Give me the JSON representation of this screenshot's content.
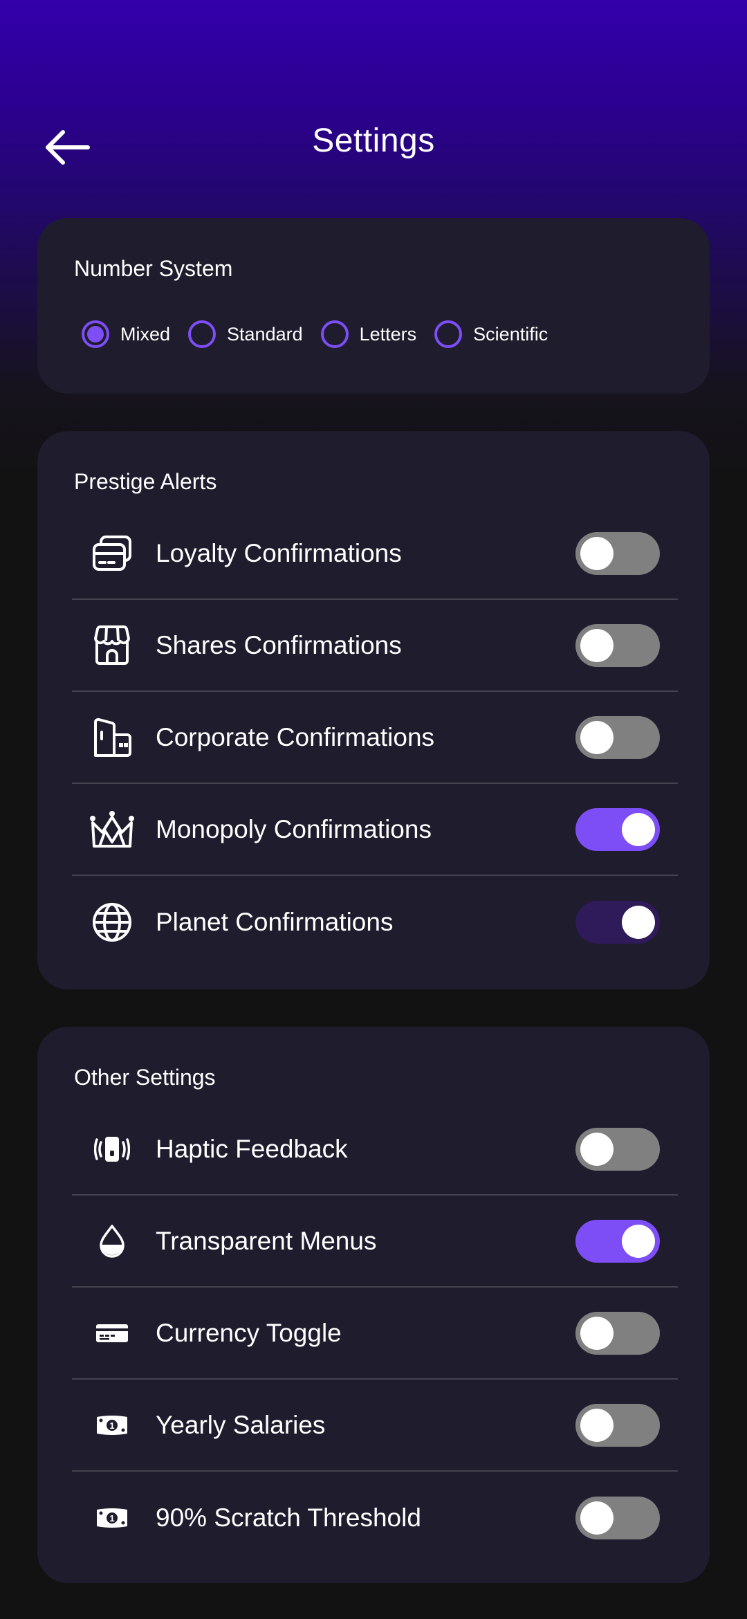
{
  "header": {
    "title": "Settings"
  },
  "number_system": {
    "title": "Number System",
    "options": [
      "Mixed",
      "Standard",
      "Letters",
      "Scientific"
    ],
    "selected": "Mixed"
  },
  "prestige_alerts": {
    "title": "Prestige Alerts",
    "items": [
      {
        "label": "Loyalty Confirmations",
        "icon": "cards-icon",
        "enabled": false
      },
      {
        "label": "Shares Confirmations",
        "icon": "storefront-icon",
        "enabled": false
      },
      {
        "label": "Corporate Confirmations",
        "icon": "buildings-icon",
        "enabled": false
      },
      {
        "label": "Monopoly Confirmations",
        "icon": "crown-icon",
        "enabled": true
      },
      {
        "label": "Planet Confirmations",
        "icon": "globe-icon",
        "enabled": true
      }
    ]
  },
  "other_settings": {
    "title": "Other Settings",
    "items": [
      {
        "label": "Haptic Feedback",
        "icon": "phone-vibrate-icon",
        "enabled": false
      },
      {
        "label": "Transparent Menus",
        "icon": "water-drop-icon",
        "enabled": true
      },
      {
        "label": "Currency Toggle",
        "icon": "card-icon",
        "enabled": false
      },
      {
        "label": "Yearly Salaries",
        "icon": "banknote-icon",
        "enabled": false
      },
      {
        "label": "90% Scratch Threshold",
        "icon": "banknote-icon",
        "enabled": false
      }
    ]
  },
  "colors": {
    "accent": "#7d4ef5",
    "toggle_off": "#808080",
    "toggle_on_dim": "#2f1a5a",
    "card_bg": "#1e1c2d",
    "page_bg": "#121212",
    "header_gradient_top": "#3300aa"
  }
}
